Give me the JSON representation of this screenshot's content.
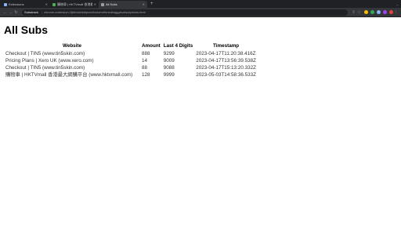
{
  "browser": {
    "tabs": [
      {
        "title": "Extensions",
        "active": false,
        "favicon_color": "#8ab4f8"
      },
      {
        "title": "購物車 | HKTVmall 香港最大網購平台",
        "active": false,
        "favicon_color": "#4caf50"
      },
      {
        "title": "All Subs",
        "active": true,
        "favicon_color": "#9aa0a6"
      }
    ],
    "new_tab_symbol": "+",
    "omnibox": {
      "chip": "Substrack",
      "url": "chrome-extension://jbfnolcbkldpcnclloclomefhnedhsjgg/subscriptions.html"
    },
    "extension_colors": [
      "#fbbc04",
      "#34a853",
      "#8ab4f8",
      "#a142f4",
      "#ea4335"
    ]
  },
  "page": {
    "title": "All Subs",
    "columns": [
      "Website",
      "Amount",
      "Last 4 Digits",
      "Timestamp"
    ],
    "rows": [
      {
        "website": "Checkout | TIN5 (www.tin5skin.com)",
        "amount": "888",
        "last4": "9299",
        "timestamp": "2023-04-17T11:20:38.416Z"
      },
      {
        "website": "Pricing Plans | Xero UK (www.xero.com)",
        "amount": "14",
        "last4": "9009",
        "timestamp": "2023-04-17T13:56:39.538Z"
      },
      {
        "website": "Checkout | TIN5 (www.tin5skin.com)",
        "amount": "88",
        "last4": "9088",
        "timestamp": "2023-04-17T15:13:20.332Z"
      },
      {
        "website": "購物車 | HKTVmall 香港最大網購平台 (www.hktvmall.com)",
        "amount": "128",
        "last4": "9999",
        "timestamp": "2023-05-03T14:58:36.533Z"
      }
    ]
  }
}
